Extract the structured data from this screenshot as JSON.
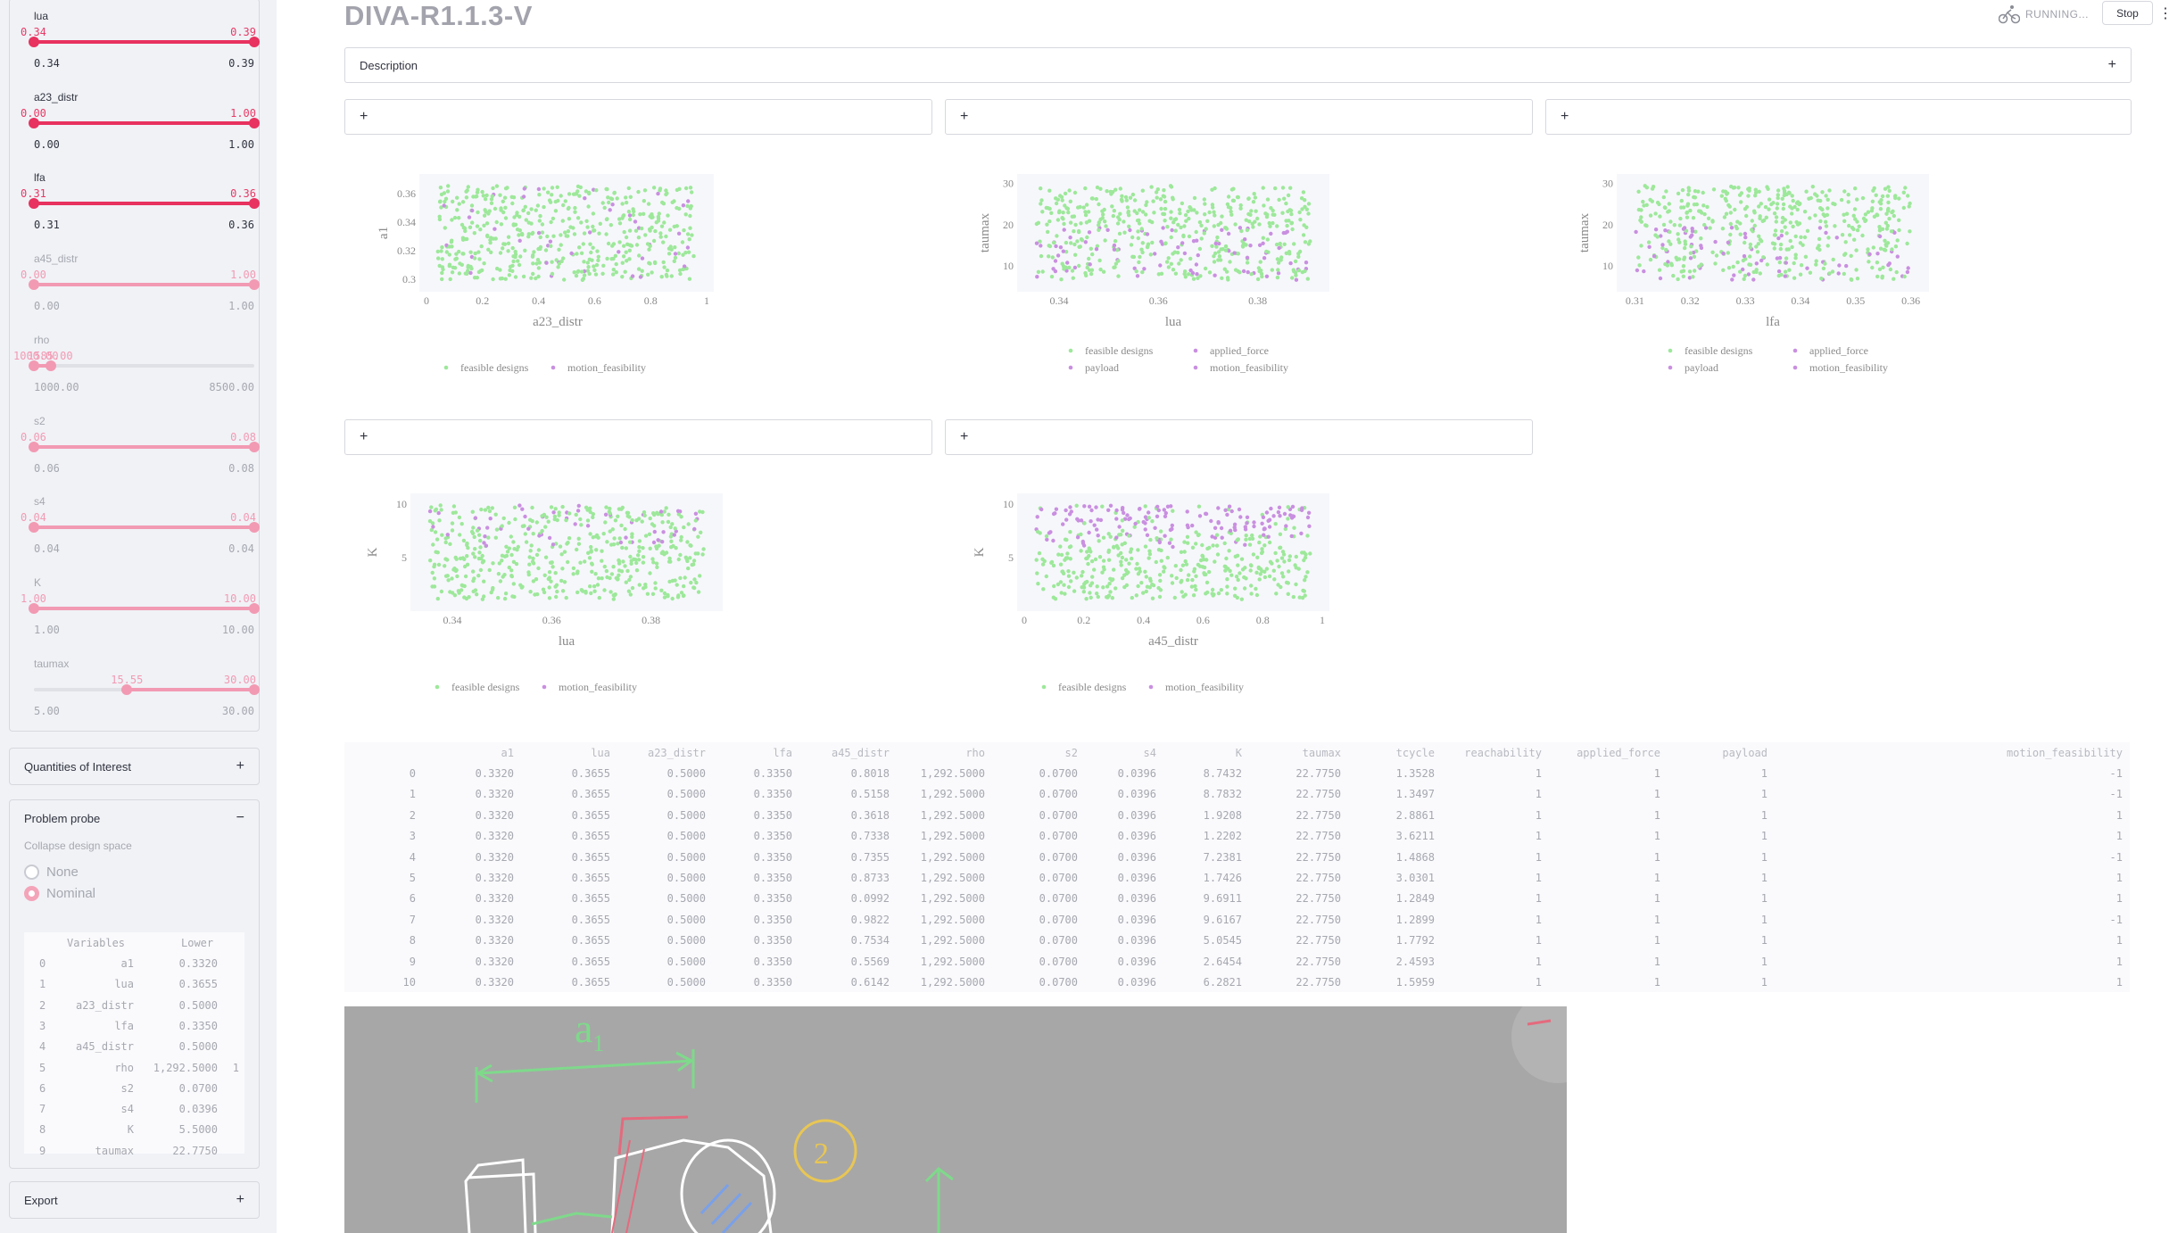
{
  "app": {
    "title": "DIVA-R1.1.3-V",
    "status": "RUNNING...",
    "stop_label": "Stop",
    "menu_icon": "more-vert-icon",
    "status_icon": "cyclist-icon"
  },
  "sidebar": {
    "sliders": [
      {
        "label": "lua",
        "min_val": "0.34",
        "max_val": "0.39",
        "tick_min": "0.34",
        "tick_max": "0.39",
        "active": true,
        "low_frac": 0.0,
        "high_frac": 1.0
      },
      {
        "label": "a23_distr",
        "min_val": "0.00",
        "max_val": "1.00",
        "tick_min": "0.00",
        "tick_max": "1.00",
        "active": true,
        "low_frac": 0.0,
        "high_frac": 1.0
      },
      {
        "label": "lfa",
        "min_val": "0.31",
        "max_val": "0.36",
        "tick_min": "0.31",
        "tick_max": "0.36",
        "active": true,
        "low_frac": 0.0,
        "high_frac": 1.0
      },
      {
        "label": "a45_distr",
        "min_val": "0.00",
        "max_val": "1.00",
        "tick_min": "0.00",
        "tick_max": "1.00",
        "active": false,
        "low_frac": 0.0,
        "high_frac": 1.0
      },
      {
        "label": "rho",
        "min_val": "1000.00",
        "max_val": "1585.00",
        "tick_min": "1000.00",
        "tick_max": "8500.00",
        "active": false,
        "low_frac": 0.0,
        "high_frac": 0.078,
        "overlap": true
      },
      {
        "label": "s2",
        "min_val": "0.06",
        "max_val": "0.08",
        "tick_min": "0.06",
        "tick_max": "0.08",
        "active": false,
        "low_frac": 0.0,
        "high_frac": 1.0
      },
      {
        "label": "s4",
        "min_val": "0.04",
        "max_val": "0.04",
        "tick_min": "0.04",
        "tick_max": "0.04",
        "active": false,
        "low_frac": 0.0,
        "high_frac": 1.0
      },
      {
        "label": "K",
        "min_val": "1.00",
        "max_val": "10.00",
        "tick_min": "1.00",
        "tick_max": "10.00",
        "active": false,
        "low_frac": 0.0,
        "high_frac": 1.0
      },
      {
        "label": "taumax",
        "min_val": "15.55",
        "max_val": "30.00",
        "tick_min": "5.00",
        "tick_max": "30.00",
        "active": false,
        "low_frac": 0.422,
        "high_frac": 1.0
      }
    ],
    "qoi_label": "Quantities of Interest",
    "probe": {
      "label": "Problem probe",
      "collapse_label": "Collapse design space",
      "options": [
        "None",
        "Nominal"
      ],
      "selected": "Nominal",
      "table_headers": [
        "Variables",
        "Lower"
      ],
      "rows": [
        [
          "0",
          "a1",
          "0.3320",
          ""
        ],
        [
          "1",
          "lua",
          "0.3655",
          ""
        ],
        [
          "2",
          "a23_distr",
          "0.5000",
          ""
        ],
        [
          "3",
          "lfa",
          "0.3350",
          ""
        ],
        [
          "4",
          "a45_distr",
          "0.5000",
          ""
        ],
        [
          "5",
          "rho",
          "1,292.5000",
          "1"
        ],
        [
          "6",
          "s2",
          "0.0700",
          ""
        ],
        [
          "7",
          "s4",
          "0.0396",
          ""
        ],
        [
          "8",
          "K",
          "5.5000",
          ""
        ],
        [
          "9",
          "taumax",
          "22.7750",
          ""
        ]
      ]
    },
    "export_label": "Export"
  },
  "main": {
    "description_label": "Description",
    "plus": "+",
    "minus": "−",
    "colors": {
      "feasible": "#9de89a",
      "infeasible": "#c98fe0",
      "accent": "#e8325f"
    },
    "legend_labels": {
      "feasible": "feasible designs",
      "motion": "motion_feasibility",
      "applied": "applied_force",
      "payload": "payload"
    }
  },
  "chart_data": [
    {
      "type": "scatter",
      "x_label": "a23_distr",
      "y_label": "a1",
      "xlim": [
        0,
        1
      ],
      "ylim": [
        0.295,
        0.37
      ],
      "x_ticks": [
        "0",
        "0.2",
        "0.4",
        "0.6",
        "0.8",
        "1"
      ],
      "y_ticks": [
        "0.3",
        "0.32",
        "0.34",
        "0.36"
      ],
      "legend": [
        "feasible designs",
        "motion_feasibility"
      ],
      "feasible_share": 0.94
    },
    {
      "type": "scatter",
      "x_label": "lua",
      "y_label": "taumax",
      "xlim": [
        0.333,
        0.393
      ],
      "ylim": [
        5,
        31
      ],
      "x_ticks": [
        "0.34",
        "0.36",
        "0.38"
      ],
      "y_ticks": [
        "10",
        "20",
        "30"
      ],
      "legend": [
        "feasible designs",
        "applied_force",
        "payload",
        "motion_feasibility"
      ],
      "feasible_share": 0.7
    },
    {
      "type": "scatter",
      "x_label": "lfa",
      "y_label": "taumax",
      "xlim": [
        0.308,
        0.362
      ],
      "ylim": [
        5,
        31
      ],
      "x_ticks": [
        "0.31",
        "0.32",
        "0.33",
        "0.34",
        "0.35",
        "0.36"
      ],
      "y_ticks": [
        "10",
        "20",
        "30"
      ],
      "legend": [
        "feasible designs",
        "applied_force",
        "payload",
        "motion_feasibility"
      ],
      "feasible_share": 0.72
    },
    {
      "type": "scatter",
      "x_label": "lua",
      "y_label": "K",
      "xlim": [
        0.333,
        0.393
      ],
      "ylim": [
        0.5,
        10.5
      ],
      "x_ticks": [
        "0.34",
        "0.36",
        "0.38"
      ],
      "y_ticks": [
        "5",
        "10"
      ],
      "legend": [
        "feasible designs",
        "motion_feasibility"
      ],
      "feasible_share": 0.8
    },
    {
      "type": "scatter",
      "x_label": "a45_distr",
      "y_label": "K",
      "xlim": [
        0,
        1
      ],
      "ylim": [
        0.5,
        10.5
      ],
      "x_ticks": [
        "0",
        "0.2",
        "0.4",
        "0.6",
        "0.8",
        "1"
      ],
      "y_ticks": [
        "5",
        "10"
      ],
      "legend": [
        "feasible designs",
        "motion_feasibility"
      ],
      "feasible_share": 0.62
    }
  ],
  "table": {
    "headers": [
      "",
      "a1",
      "lua",
      "a23_distr",
      "lfa",
      "a45_distr",
      "rho",
      "s2",
      "s4",
      "K",
      "taumax",
      "tcycle",
      "reachability",
      "applied_force",
      "payload",
      "motion_feasibility"
    ],
    "rows": [
      [
        "0",
        "0.3320",
        "0.3655",
        "0.5000",
        "0.3350",
        "0.8018",
        "1,292.5000",
        "0.0700",
        "0.0396",
        "8.7432",
        "22.7750",
        "1.3528",
        "1",
        "1",
        "1",
        "-1"
      ],
      [
        "1",
        "0.3320",
        "0.3655",
        "0.5000",
        "0.3350",
        "0.5158",
        "1,292.5000",
        "0.0700",
        "0.0396",
        "8.7832",
        "22.7750",
        "1.3497",
        "1",
        "1",
        "1",
        "-1"
      ],
      [
        "2",
        "0.3320",
        "0.3655",
        "0.5000",
        "0.3350",
        "0.3618",
        "1,292.5000",
        "0.0700",
        "0.0396",
        "1.9208",
        "22.7750",
        "2.8861",
        "1",
        "1",
        "1",
        "1"
      ],
      [
        "3",
        "0.3320",
        "0.3655",
        "0.5000",
        "0.3350",
        "0.7338",
        "1,292.5000",
        "0.0700",
        "0.0396",
        "1.2202",
        "22.7750",
        "3.6211",
        "1",
        "1",
        "1",
        "1"
      ],
      [
        "4",
        "0.3320",
        "0.3655",
        "0.5000",
        "0.3350",
        "0.7355",
        "1,292.5000",
        "0.0700",
        "0.0396",
        "7.2381",
        "22.7750",
        "1.4868",
        "1",
        "1",
        "1",
        "-1"
      ],
      [
        "5",
        "0.3320",
        "0.3655",
        "0.5000",
        "0.3350",
        "0.8733",
        "1,292.5000",
        "0.0700",
        "0.0396",
        "1.7426",
        "22.7750",
        "3.0301",
        "1",
        "1",
        "1",
        "1"
      ],
      [
        "6",
        "0.3320",
        "0.3655",
        "0.5000",
        "0.3350",
        "0.0992",
        "1,292.5000",
        "0.0700",
        "0.0396",
        "9.6911",
        "22.7750",
        "1.2849",
        "1",
        "1",
        "1",
        "1"
      ],
      [
        "7",
        "0.3320",
        "0.3655",
        "0.5000",
        "0.3350",
        "0.9822",
        "1,292.5000",
        "0.0700",
        "0.0396",
        "9.6167",
        "22.7750",
        "1.2899",
        "1",
        "1",
        "1",
        "-1"
      ],
      [
        "8",
        "0.3320",
        "0.3655",
        "0.5000",
        "0.3350",
        "0.7534",
        "1,292.5000",
        "0.0700",
        "0.0396",
        "5.0545",
        "22.7750",
        "1.7792",
        "1",
        "1",
        "1",
        "1"
      ],
      [
        "9",
        "0.3320",
        "0.3655",
        "0.5000",
        "0.3350",
        "0.5569",
        "1,292.5000",
        "0.0700",
        "0.0396",
        "2.6454",
        "22.7750",
        "2.4593",
        "1",
        "1",
        "1",
        "1"
      ],
      [
        "10",
        "0.3320",
        "0.3655",
        "0.5000",
        "0.3350",
        "0.6142",
        "1,292.5000",
        "0.0700",
        "0.0396",
        "6.2821",
        "22.7750",
        "1.5959",
        "1",
        "1",
        "1",
        "1"
      ]
    ]
  },
  "sketch": {
    "label_a1": "a1",
    "circle_label": "2"
  }
}
